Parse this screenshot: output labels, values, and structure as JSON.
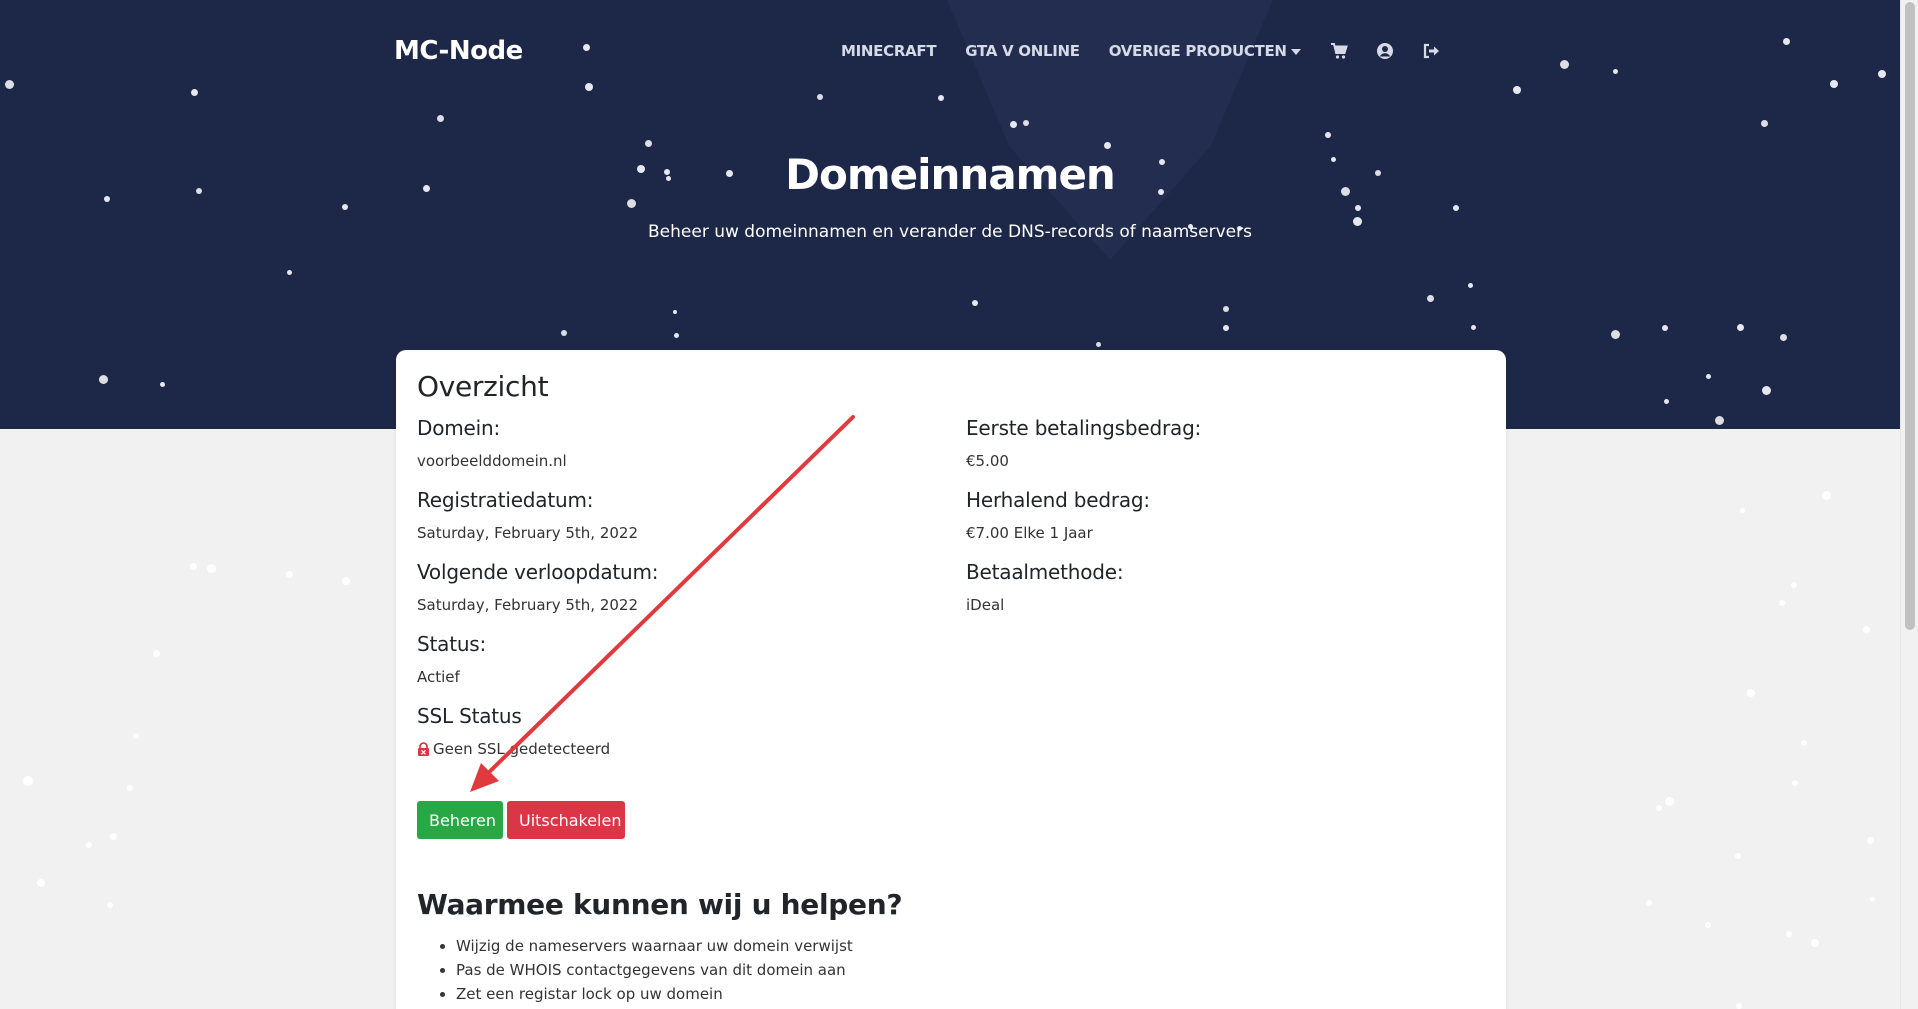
{
  "brand": "MC-Node",
  "nav": {
    "items": [
      "MINECRAFT",
      "GTA V ONLINE",
      "OVERIGE PRODUCTEN"
    ],
    "icons": [
      "cart-icon",
      "user-circle-icon",
      "sign-out-icon"
    ]
  },
  "hero": {
    "title": "Domeinnamen",
    "subtitle": "Beheer uw domeinnamen en verander de DNS-records of naamservers"
  },
  "overview": {
    "title": "Overzicht",
    "left": [
      {
        "label": "Domein:",
        "value": "voorbeelddomein.nl"
      },
      {
        "label": "Registratiedatum:",
        "value": "Saturday, February 5th, 2022"
      },
      {
        "label": "Volgende verloopdatum:",
        "value": "Saturday, February 5th, 2022"
      },
      {
        "label": "Status:",
        "value": "Actief"
      },
      {
        "label": "SSL Status",
        "value": "Geen SSL gedetecteerd"
      }
    ],
    "right": [
      {
        "label": "Eerste betalingsbedrag:",
        "value": "€5.00"
      },
      {
        "label": "Herhalend bedrag:",
        "value": "€7.00 Elke 1 Jaar"
      },
      {
        "label": "Betaalmethode:",
        "value": "iDeal"
      }
    ],
    "buttons": {
      "manage": "Beheren",
      "disable": "Uitschakelen"
    }
  },
  "help": {
    "title": "Waarmee kunnen wij u helpen?",
    "items": [
      "Wijzig de nameservers waarnaar uw domein verwijst",
      "Pas de WHOIS contactgegevens van dit domein aan",
      "Zet een registar lock op uw domein"
    ]
  },
  "colors": {
    "hero_bg": "#1d2747",
    "manage_button": "#28a745",
    "disable_button": "#dc3545",
    "annotation_arrow": "#e0393e"
  }
}
